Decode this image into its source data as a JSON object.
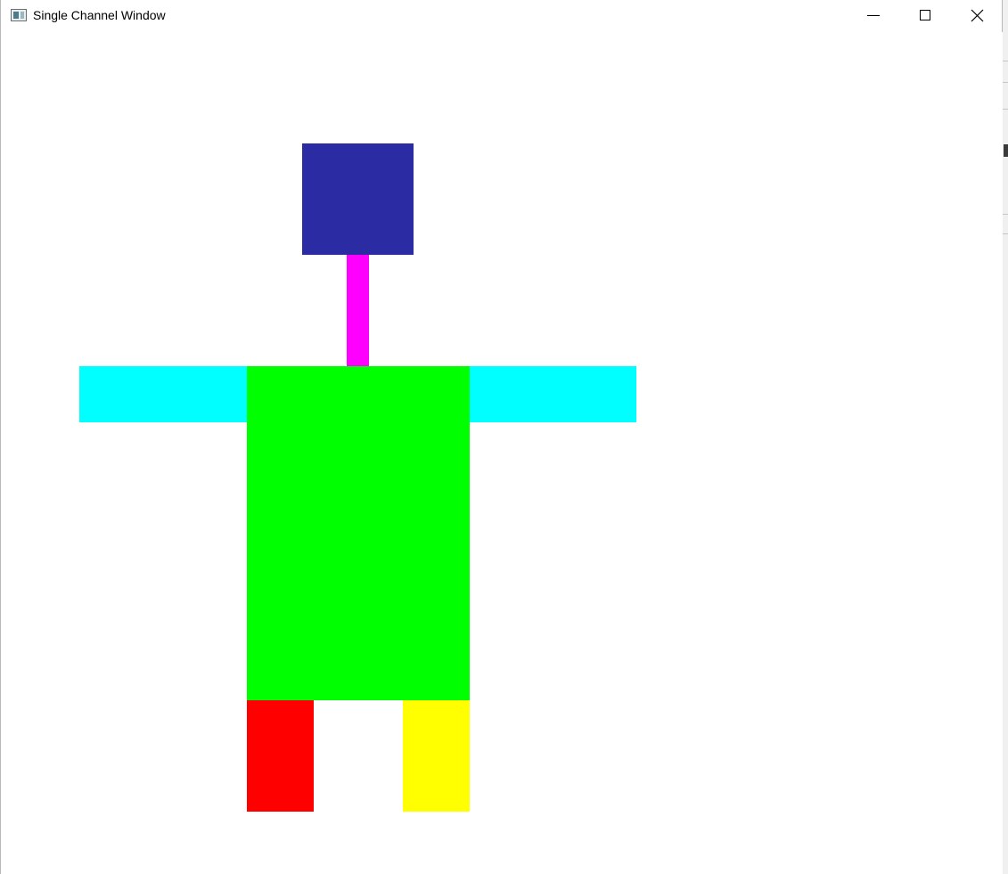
{
  "window": {
    "title": "Single Channel Window",
    "controls": {
      "minimize": "minimize-icon",
      "maximize": "maximize-icon",
      "close": "close-icon"
    }
  },
  "figure": {
    "background": "#ffffff",
    "parts": [
      {
        "name": "head",
        "color": "#2b2ba4"
      },
      {
        "name": "neck",
        "color": "#ff00ff"
      },
      {
        "name": "left-arm",
        "color": "#00ffff"
      },
      {
        "name": "right-arm",
        "color": "#00ffff"
      },
      {
        "name": "torso",
        "color": "#00ff00"
      },
      {
        "name": "left-leg",
        "color": "#ff0000"
      },
      {
        "name": "right-leg",
        "color": "#ffff00"
      }
    ]
  }
}
